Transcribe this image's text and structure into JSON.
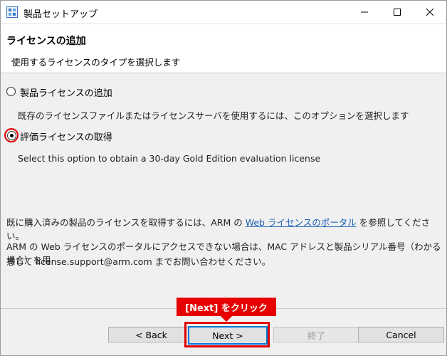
{
  "window": {
    "title": "製品セットアップ",
    "icon": "setup-app-icon"
  },
  "header": {
    "title": "ライセンスの追加",
    "subtitle": "使用するライセンスのタイプを選択します"
  },
  "options": [
    {
      "label": "製品ライセンスの追加",
      "description": "既存のライセンスファイルまたはライセンスサーバを使用するには、このオプションを選択します",
      "selected": false
    },
    {
      "label": "評価ライセンスの取得",
      "description": "Select this option to obtain a 30-day Gold Edition evaluation license",
      "selected": true
    }
  ],
  "info": {
    "para1_before": "既に購入済みの製品のライセンスを取得するには、ARM の ",
    "para1_link": "Web ライセンスのポータル",
    "para1_after": " を参照してください。",
    "para2_line1": "ARM の Web ライセンスのポータルにアクセスできない場合は、MAC アドレスと製品シリアル番号（わかる場合）を用",
    "para2_line2": "意して license.support@arm.com までお問い合わせください。"
  },
  "buttons": {
    "back": "< Back",
    "next": "Next >",
    "finish": "終了",
    "cancel": "Cancel"
  },
  "annotation": {
    "callout": "[Next] をクリック",
    "color": "#e60000"
  }
}
